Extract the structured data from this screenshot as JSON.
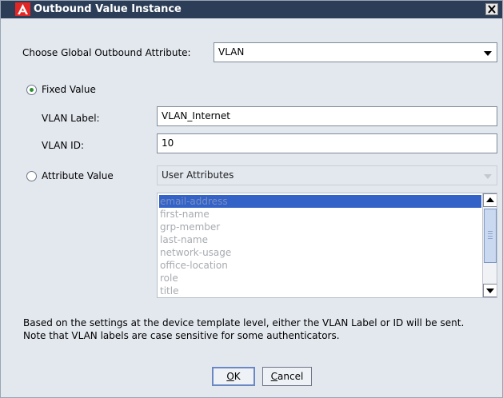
{
  "dialog": {
    "title": "Outbound Value Instance",
    "close_icon": "close-x-icon"
  },
  "global_attribute": {
    "label": "Choose Global Outbound Attribute:",
    "value": "VLAN"
  },
  "fixed_value": {
    "label": "Fixed Value",
    "selected": true,
    "vlan_label_caption": "VLAN Label:",
    "vlan_label_value": "VLAN_Internet",
    "vlan_id_caption": "VLAN ID:",
    "vlan_id_value": "10"
  },
  "attribute_value": {
    "label": "Attribute Value",
    "selected": false,
    "source": "User Attributes",
    "items": [
      "email-address",
      "first-name",
      "grp-member",
      "last-name",
      "network-usage",
      "office-location",
      "role",
      "title"
    ],
    "selected_index": 0
  },
  "note": {
    "line1": "Based on the settings at the device template level, either the VLAN Label or ID will be sent.",
    "line2": "Note that VLAN labels are case sensitive for some authenticators."
  },
  "buttons": {
    "ok": {
      "label": "OK",
      "mnemonic": "O",
      "rest": "K"
    },
    "cancel": {
      "label": "Cancel",
      "mnemonic": "C",
      "rest": "ancel"
    }
  },
  "colors": {
    "title_bar": "#2c3e57",
    "logo": "#e22626",
    "selection": "#3463c7",
    "dialog_bg": "#e3e8ef"
  }
}
